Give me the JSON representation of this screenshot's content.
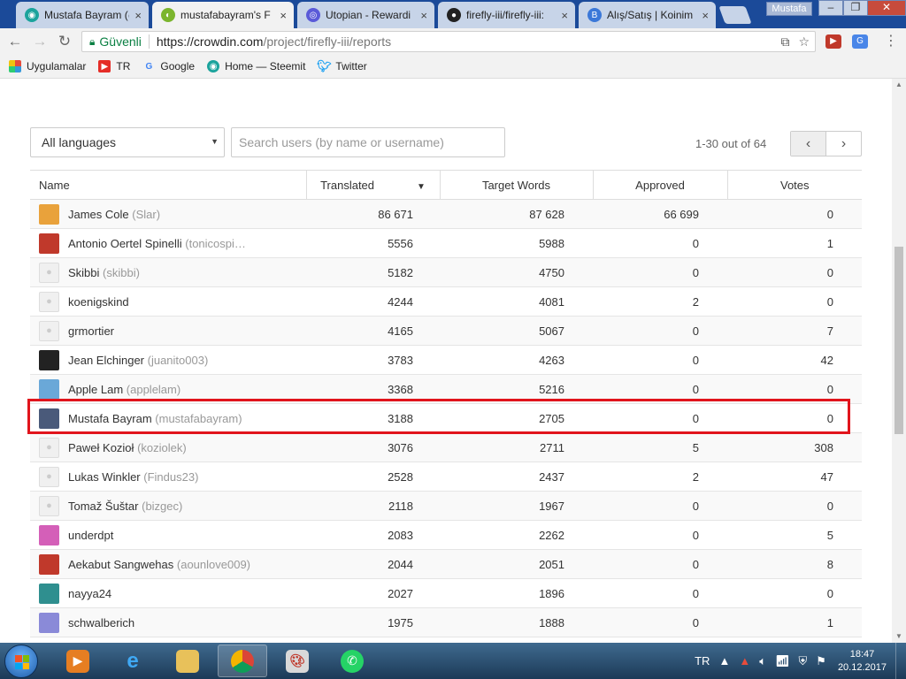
{
  "browser": {
    "tabs": [
      {
        "title": "Mustafa Bayram (@",
        "favicon_color": "#1ba39c"
      },
      {
        "title": "mustafabayram's F",
        "favicon_color": "#7bb52d"
      },
      {
        "title": "Utopian - Rewardi",
        "favicon_color": "#5a5ad8"
      },
      {
        "title": "firefly-iii/firefly-iii:",
        "favicon_color": "#222222"
      },
      {
        "title": "Alış/Satış | Koinim",
        "favicon_color": "#3b78d8"
      }
    ],
    "profile_name": "Mustafa",
    "secure_label": "Güvenli",
    "url_host": "https://crowdin.com",
    "url_path": "/project/firefly-iii/reports",
    "bookmarks": [
      {
        "label": "Uygulamalar",
        "icon": "apps-grid-icon"
      },
      {
        "label": "TR",
        "icon": "youtube-icon"
      },
      {
        "label": "Google",
        "icon": "google-icon"
      },
      {
        "label": "Home — Steemit",
        "icon": "steemit-icon"
      },
      {
        "label": "Twitter",
        "icon": "twitter-icon"
      }
    ]
  },
  "filters": {
    "language": "All languages",
    "search_placeholder": "Search users (by name or username)",
    "page_count": "1-30 out of 64"
  },
  "table": {
    "headers": {
      "name": "Name",
      "translated": "Translated",
      "target_words": "Target Words",
      "approved": "Approved",
      "votes": "Votes"
    },
    "rows": [
      {
        "name": "James Cole",
        "login": "(Slar)",
        "translated": "86 671",
        "target_words": "87 628",
        "approved": "66 699",
        "votes": "0",
        "avatar_color": "#e9a23b"
      },
      {
        "name": "Antonio Oertel Spinelli",
        "login": "(tonicospi…",
        "translated": "5556",
        "target_words": "5988",
        "approved": "0",
        "votes": "1",
        "avatar_color": "#c0392b"
      },
      {
        "name": "Skibbi",
        "login": "(skibbi)",
        "translated": "5182",
        "target_words": "4750",
        "approved": "0",
        "votes": "0",
        "avatar_color": ""
      },
      {
        "name": "koenigskind",
        "login": "",
        "translated": "4244",
        "target_words": "4081",
        "approved": "2",
        "votes": "0",
        "avatar_color": ""
      },
      {
        "name": "grmortier",
        "login": "",
        "translated": "4165",
        "target_words": "5067",
        "approved": "0",
        "votes": "7",
        "avatar_color": ""
      },
      {
        "name": "Jean Elchinger",
        "login": "(juanito003)",
        "translated": "3783",
        "target_words": "4263",
        "approved": "0",
        "votes": "42",
        "avatar_color": "#222222"
      },
      {
        "name": "Apple Lam",
        "login": "(applelam)",
        "translated": "3368",
        "target_words": "5216",
        "approved": "0",
        "votes": "0",
        "avatar_color": "#6aa8d8"
      },
      {
        "name": "Mustafa Bayram",
        "login": "(mustafabayram)",
        "translated": "3188",
        "target_words": "2705",
        "approved": "0",
        "votes": "0",
        "avatar_color": "#4a5a7a"
      },
      {
        "name": "Paweł Kozioł",
        "login": "(koziolek)",
        "translated": "3076",
        "target_words": "2711",
        "approved": "5",
        "votes": "308",
        "avatar_color": ""
      },
      {
        "name": "Lukas Winkler",
        "login": "(Findus23)",
        "translated": "2528",
        "target_words": "2437",
        "approved": "2",
        "votes": "47",
        "avatar_color": ""
      },
      {
        "name": "Tomaž Šuštar",
        "login": "(bizgec)",
        "translated": "2118",
        "target_words": "1967",
        "approved": "0",
        "votes": "0",
        "avatar_color": ""
      },
      {
        "name": "underdpt",
        "login": "",
        "translated": "2083",
        "target_words": "2262",
        "approved": "0",
        "votes": "5",
        "avatar_color": "#d45fb8"
      },
      {
        "name": "Aekabut Sangwehas",
        "login": "(aounlove009)",
        "translated": "2044",
        "target_words": "2051",
        "approved": "0",
        "votes": "8",
        "avatar_color": "#c0392b"
      },
      {
        "name": "nayya24",
        "login": "",
        "translated": "2027",
        "target_words": "1896",
        "approved": "0",
        "votes": "0",
        "avatar_color": "#2f8f8f"
      },
      {
        "name": "schwalberich",
        "login": "",
        "translated": "1975",
        "target_words": "1888",
        "approved": "0",
        "votes": "1",
        "avatar_color": "#8a8ad8"
      }
    ]
  },
  "taskbar": {
    "language": "TR",
    "time": "18:47",
    "date": "20.12.2017"
  }
}
